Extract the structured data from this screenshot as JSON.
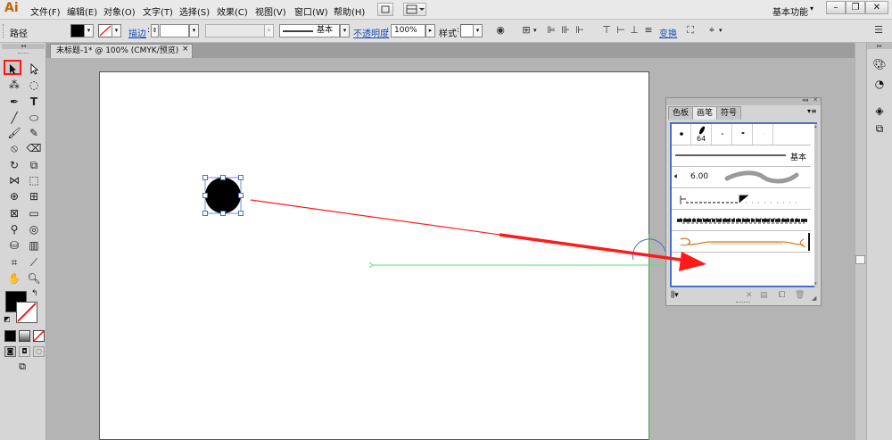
{
  "app": {
    "logo": "Ai",
    "workspace": "基本功能"
  },
  "menu": [
    "文件(F)",
    "编辑(E)",
    "对象(O)",
    "文字(T)",
    "选择(S)",
    "效果(C)",
    "视图(V)",
    "窗口(W)",
    "帮助(H)"
  ],
  "controlbar": {
    "selection_label": "路径",
    "stroke_label": "描边",
    "stroke_style": "基本",
    "opacity_label": "不透明度",
    "opacity_value": "100%",
    "style_label": "样式",
    "transform_label": "变换"
  },
  "document": {
    "tab_title": "未标题-1* @ 100% (CMYK/预览)",
    "close_glyph": "×"
  },
  "panel": {
    "tabs": [
      "色板",
      "画笔",
      "符号"
    ],
    "active_tab": "画笔",
    "calligraphic_size": "64",
    "basic_brush_label": "基本",
    "art_brush_size": "6.00",
    "menu_glyph": "▾≡",
    "collapse_glyph": "◂◂"
  },
  "colors": {
    "annotation_red": "#ff1a1a",
    "guide_green": "#5fe36b",
    "selection_blue": "#4a6fc8",
    "ai_orange": "#c8630c"
  }
}
